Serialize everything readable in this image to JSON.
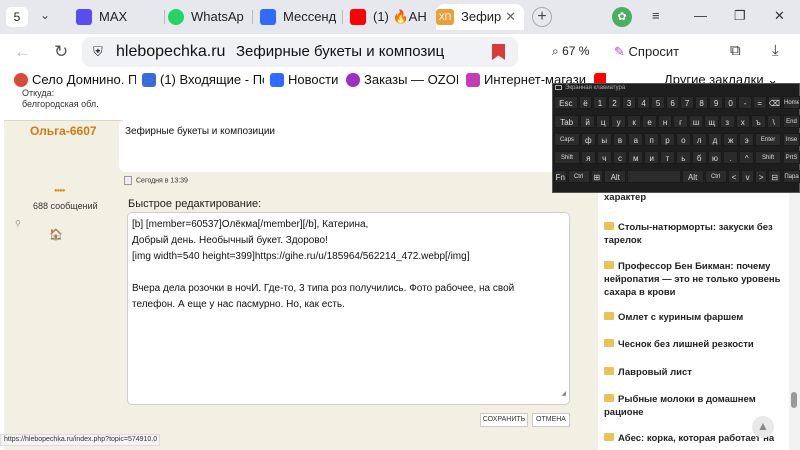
{
  "tabs": {
    "count": "5",
    "items": [
      {
        "label": "MAX"
      },
      {
        "label": "WhatsAp"
      },
      {
        "label": "Мессенд"
      },
      {
        "label": "(1) 🔥АН"
      },
      {
        "label": "Зефир",
        "icon_text": "ХП"
      }
    ]
  },
  "address": {
    "host": "hlebopechka.ru",
    "page_title": "Зефирные букеты и композиц",
    "zoom": "67 %",
    "ask_label": "Спросит"
  },
  "bookmarks": {
    "items": [
      "Село Домнино. П",
      "(1) Входящие - По",
      "Новости",
      "Заказы — OZON",
      "Интернет-магази"
    ],
    "other": "Другие закладки"
  },
  "prev_post": {
    "location": "Откуда: белгородская обл."
  },
  "post": {
    "author": "Ольга-6607",
    "subject": "Зефирные букеты и композиции",
    "date": "Сегодня в 13:39",
    "stars": "●●●●",
    "message_count": "688 сообщений"
  },
  "quick_edit": {
    "label": "Быстрое редактирование:",
    "lines": [
      "[b] [member=60537]Олёкма[/member][/b], Катерина,",
      "Добрый день. Необычный букет. Здорово!",
      "[img width=540 height=399]https://gihe.ru/u/185964/562214_472.webp[/img]",
      "",
      "Вчера дела розочки в ночИ. Где-то, 3 типа роз получились. Фото рабочее, на свой",
      "телефон. А еще у нас пасмурно. Но, как есть."
    ],
    "save_label": "СОХРАНИТЬ",
    "cancel_label": "ОТМЕНА"
  },
  "status_url": "https://hlebopechka.ru/index.php?topic=574910.0",
  "sidebar": {
    "items": [
      "характер",
      "Столы-натюрморты: закуски без тарелок",
      "Профессор Бен Бикман: почему нейропатия — это не только уровень сахара в крови",
      "Омлет с куриным фаршем",
      "Чеснок без лишней резкости",
      "Лавровый лист",
      "Рыбные молоки в домашнем рационе",
      "Абес: корка, которая работает на"
    ]
  },
  "osk": {
    "title": "Экранная клавиатура",
    "rows": [
      [
        "Esc",
        "ё",
        "1",
        "2",
        "3",
        "4",
        "5",
        "6",
        "7",
        "8",
        "9",
        "0",
        "-",
        "=",
        "⌫"
      ],
      [
        "Tab",
        "й",
        "ц",
        "у",
        "к",
        "е",
        "н",
        "г",
        "ш",
        "щ",
        "з",
        "х",
        "ъ",
        "\\"
      ],
      [
        "Caps",
        "ф",
        "ы",
        "в",
        "а",
        "п",
        "р",
        "о",
        "л",
        "д",
        "ж",
        "э",
        "Enter"
      ],
      [
        "Shift",
        "я",
        "ч",
        "с",
        "м",
        "и",
        "т",
        "ь",
        "б",
        "ю",
        ".",
        "^",
        "Shift"
      ],
      [
        "Fn",
        "Ctrl",
        "⊞",
        "Alt",
        "",
        "Alt",
        "Ctrl",
        "<",
        "v",
        ">",
        "⊟"
      ]
    ],
    "side_keys": [
      "Home",
      "End",
      "Inse",
      "PrtS",
      "Пара"
    ]
  },
  "colors": {
    "author": "#d27a14",
    "post_bg": "#f2efe3",
    "bookmark_red": "#d93a3a",
    "folder": "#e9c357"
  }
}
